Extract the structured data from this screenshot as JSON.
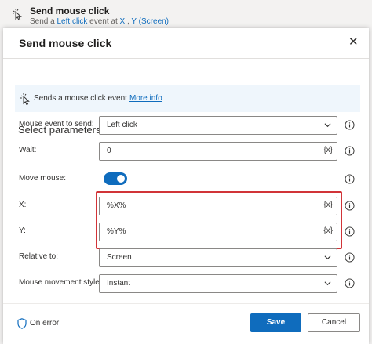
{
  "action": {
    "title": "Send mouse click",
    "sub_prefix": "Send a",
    "sub_click": "Left click",
    "sub_middle": "event at",
    "sub_x": "X",
    "sub_comma": ",",
    "sub_y": "Y",
    "sub_screen": "(Screen)",
    "icon": "mouse-click-icon"
  },
  "dialog": {
    "title": "Send mouse click",
    "close_label": "✕",
    "banner_text": "Sends a mouse click event",
    "banner_link": "More info",
    "section_title": "Select parameters"
  },
  "fields": {
    "mouse_event": {
      "label": "Mouse event to send:",
      "value": "Left click"
    },
    "wait": {
      "label": "Wait:",
      "value": "0",
      "var_button": "{x}"
    },
    "move_mouse": {
      "label": "Move mouse:",
      "on": true
    },
    "x": {
      "label": "X:",
      "value": "%X%",
      "var_button": "{x}"
    },
    "y": {
      "label": "Y:",
      "value": "%Y%",
      "var_button": "{x}"
    },
    "relative_to": {
      "label": "Relative to:",
      "value": "Screen"
    },
    "movement_style": {
      "label": "Mouse movement style:",
      "value": "Instant"
    }
  },
  "footer": {
    "on_error": "On error",
    "save": "Save",
    "cancel": "Cancel"
  },
  "colors": {
    "accent": "#0f6cbd",
    "highlight": "#d13438",
    "banner_bg": "#eff6fc"
  }
}
